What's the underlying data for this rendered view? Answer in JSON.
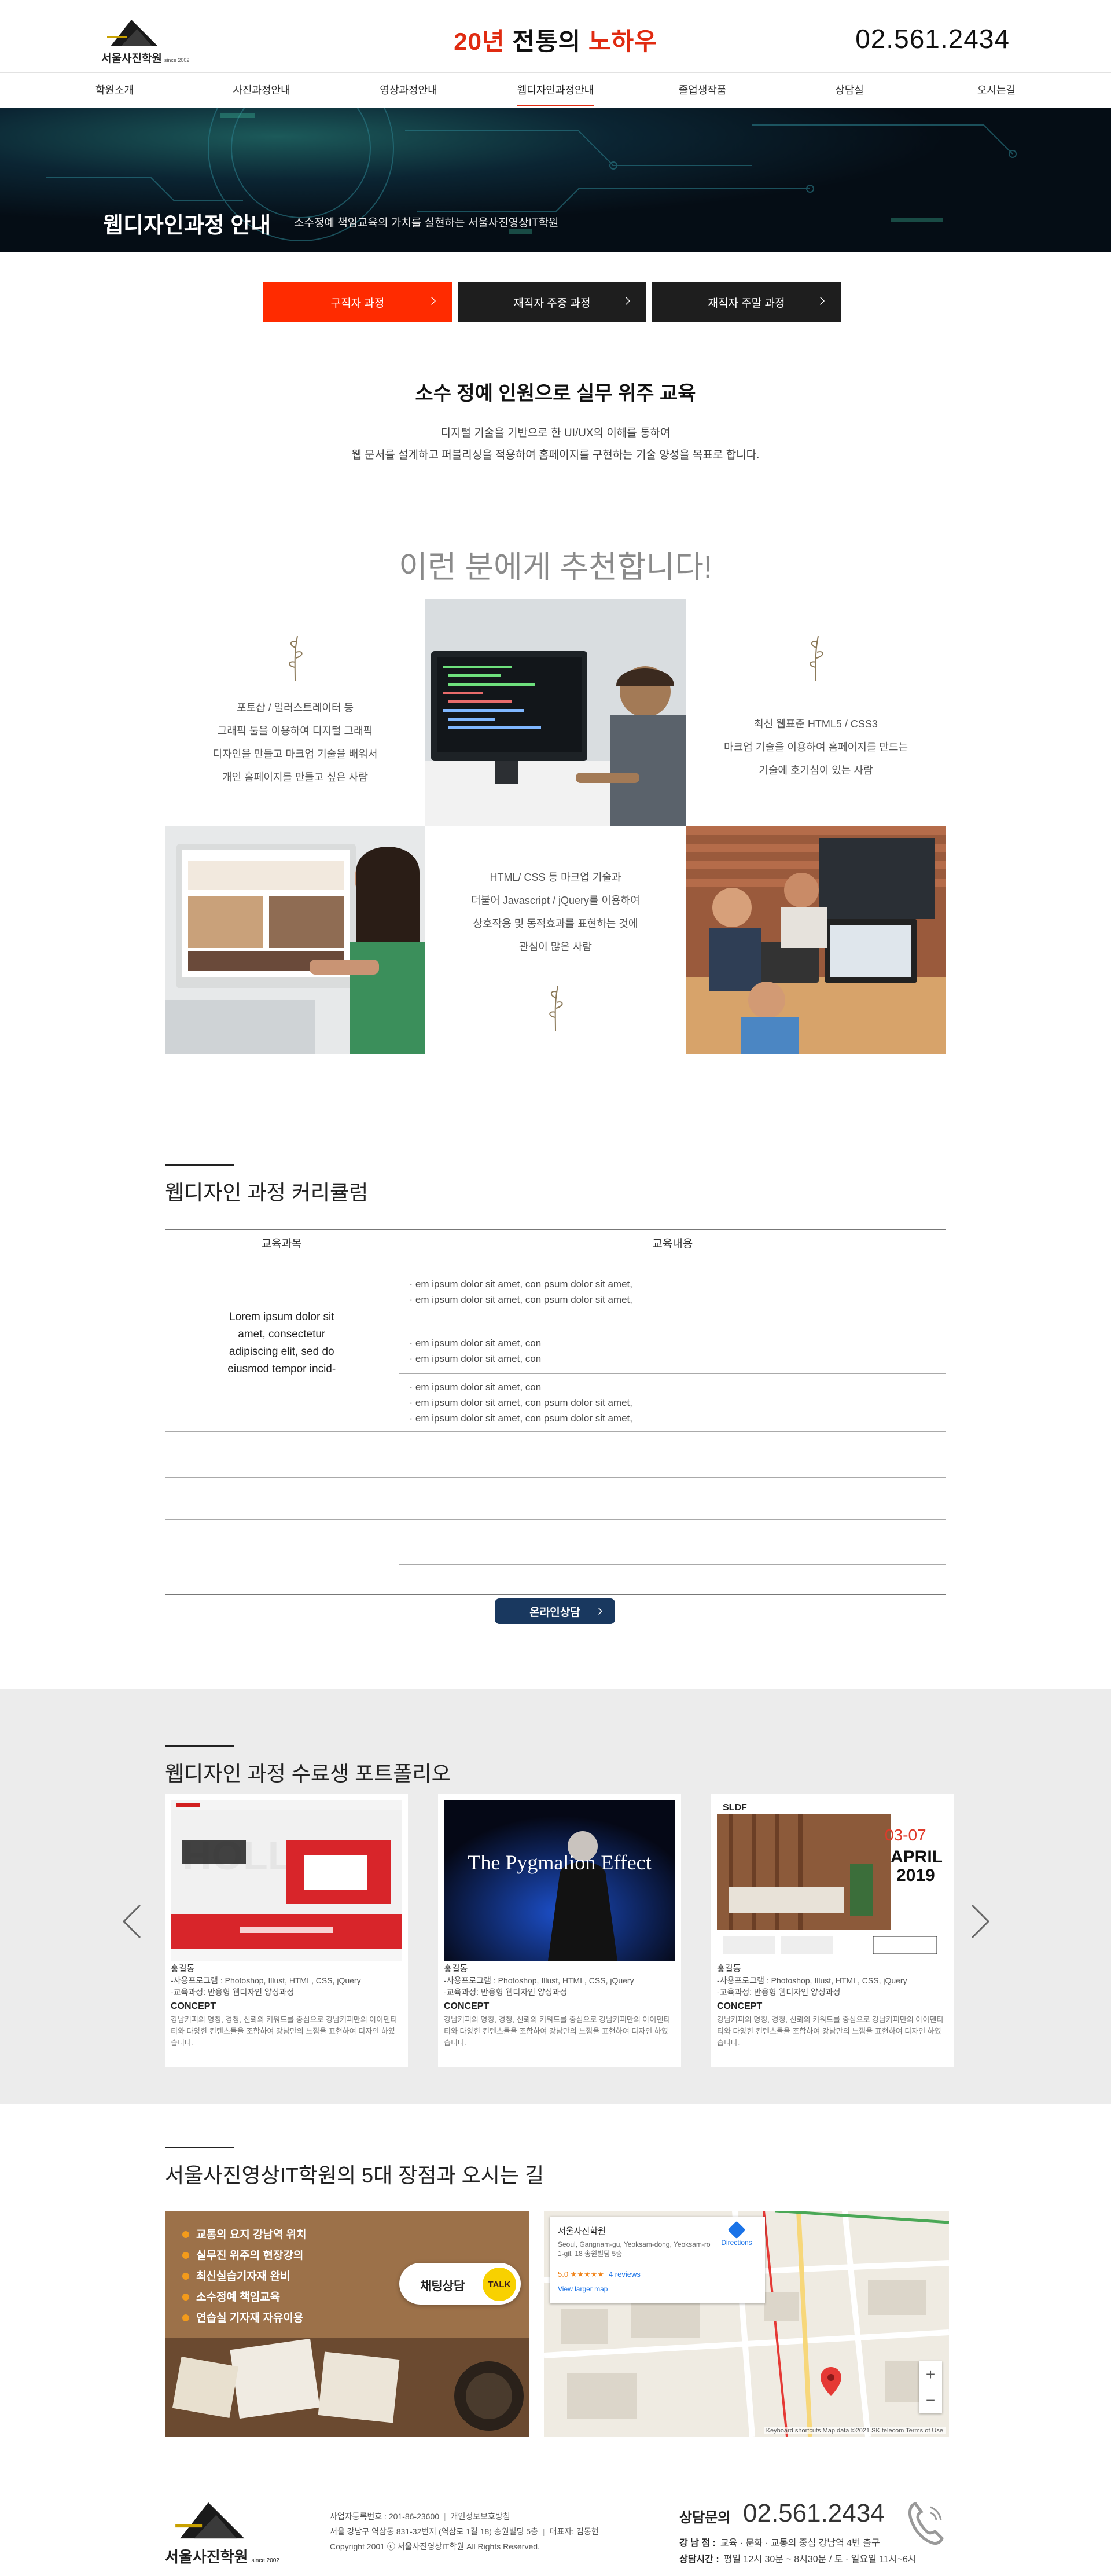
{
  "header": {
    "logo_text": "서울사진학원",
    "logo_since": "since 2002",
    "tagline_a": "20년",
    "tagline_b": " 전통의 ",
    "tagline_c": "노하우",
    "phone": "02.561.2434"
  },
  "nav": [
    "학원소개",
    "사진과정안내",
    "영상과정안내",
    "웹디자인과정안내",
    "졸업생작품",
    "상담실",
    "오시는길"
  ],
  "banner": {
    "title": "웹디자인과정 안내",
    "subtitle": "소수정예 책임교육의 가치를 실현하는 서울사진영상IT학원"
  },
  "tabs": [
    "구직자 과정",
    "재직자 주중 과정",
    "재직자 주말 과정"
  ],
  "intro": {
    "title": "소수 정예 인원으로 실무 위주 교육",
    "line1": "디지털 기술을 기반으로 한  UI/UX의 이해를 통하여",
    "line2": "웹 문서를 설계하고 퍼블리싱을 적용하여 홈페이지를 구현하는 기술 양성을 목표로 합니다."
  },
  "recommend": {
    "title": "이런 분에게 추천합니다!",
    "box1": [
      "포토샵 / 일러스트레이터 등",
      "그래픽 툴을 이용하여 디지털 그래픽",
      "디자인을 만들고 마크업 기술을 배워서",
      "개인 홈페이지를 만들고 싶은 사람"
    ],
    "box2": [
      "최신 웹표준 HTML5 / CSS3",
      "마크업 기술을 이용하여 홈페이지를 만드는",
      "기술에 호기심이 있는 사람"
    ],
    "box3": [
      "HTML/ CSS 등 마크업 기술과",
      "더불어 Javascript / jQuery를 이용하여",
      "상호작용 및 동적효과를 표현하는 것에",
      "관심이 많은 사람"
    ]
  },
  "curriculum": {
    "title": "웹디자인 과정 커리큘럼",
    "col_subject": "교육과목",
    "col_content": "교육내용",
    "subject": "Lorem ipsum dolor sit amet, consectetur adipiscing elit, sed do eiusmod tempor incid-",
    "block1": [
      "· em ipsum dolor sit amet, con psum dolor sit amet,",
      "· em ipsum dolor sit amet, con psum dolor sit amet,"
    ],
    "block2": [
      "· em ipsum dolor sit amet, con",
      "· em ipsum dolor sit amet, con"
    ],
    "block3": [
      "· em ipsum dolor sit amet, con",
      "· em ipsum dolor sit amet, con psum dolor sit amet,",
      "· em ipsum dolor sit amet, con psum dolor sit amet,"
    ],
    "button": "온라인상담"
  },
  "portfolio": {
    "title": "웹디자인 과정 수료생 포트폴리오",
    "items": [
      {
        "name": "홍길동",
        "program": "-사용프로그램 : Photoshop, Illust, HTML, CSS, jQuery",
        "course": "-교육과정: 반응형 웹디자인 양성과정",
        "concept_label": "CONCEPT",
        "concept": "강남커피의 명칭, 경청, 신뢰의 키워드를 중심으로 강남커피만의 아이덴티티와 다양한 컨텐츠들을 조합하여 강남만의 느낌을 표현하여 디자인 하였습니다."
      },
      {
        "name": "홍길동",
        "program": "-사용프로그램 : Photoshop, Illust, HTML, CSS, jQuery",
        "course": "-교육과정: 반응형 웹디자인 양성과정",
        "concept_label": "CONCEPT",
        "concept": "강남커피의 명칭, 경청, 신뢰의 키워드를 중심으로 강남커피만의 아이덴티티와 다양한 컨텐츠들을 조합하여 강남만의 느낌을 표현하여 디자인 하였습니다.",
        "shot_text": "The Pygmalion Effect"
      },
      {
        "name": "홍길동",
        "program": "-사용프로그램 : Photoshop, Illust, HTML, CSS, jQuery",
        "course": "-교육과정: 반응형 웹디자인 양성과정",
        "concept_label": "CONCEPT",
        "concept": "강남커피의 명칭, 경청, 신뢰의 키워드를 중심으로 강남커피만의 아이덴티티와 다양한 컨텐츠들을 조합하여 강남만의 느낌을 표현하여 디자인 하였습니다.",
        "shot_date": "03-07",
        "shot_month": "APRIL",
        "shot_year": "2019",
        "shot_brand": "SLDF"
      }
    ]
  },
  "location": {
    "title": "서울사진영상IT학원의 5대 장점과 오시는 길",
    "points": [
      "교통의 요지 강남역 위치",
      "실무진 위주의 현장강의",
      "최신실습기자재 완비",
      "소수정예 책임교육",
      "연습실 기자재 자유이용"
    ],
    "chat_label": "채팅상담",
    "talk": "TALK",
    "map": {
      "name": "서울사진학원",
      "address": "Seoul, Gangnam-gu, Yeoksam-dong, Yeoksam-ro 1-gil, 18 송원빌딩 5층",
      "rating": "5.0 ★★★★★",
      "reviews": "4 reviews",
      "larger": "View larger map",
      "directions": "Directions",
      "footer": "Keyboard shortcuts   Map data ©2021 SK telecom   Terms of Use"
    }
  },
  "footer": {
    "logo_text": "서울사진학원",
    "logo_since": "since 2002",
    "biz_no": "사업자등록번호 : 201-86-23600",
    "privacy": "개인정보보호방침",
    "address": "서울 강남구 역삼동 831-32번지 (역삼로 1길 18) 송원빌딩 5층",
    "ceo": "대표자: 김동현",
    "copyright": "Copyright 2001 ⓒ 서울사진영상IT학원   All Rights Reserved.",
    "phone_label": "상담문의",
    "phone": "02.561.2434",
    "branch_label": "강 남 점 :",
    "branch": "교육 · 문화 · 교통의 중심  강남역 4번 출구",
    "hours_label": "상담시간 :",
    "hours": "평일 12시 30분 ~ 8시30분 / 토 · 일요일  11시~6시"
  },
  "colors": {
    "accent": "#ff2b00",
    "navy": "#19385f",
    "dark": "#1e1e1e"
  }
}
